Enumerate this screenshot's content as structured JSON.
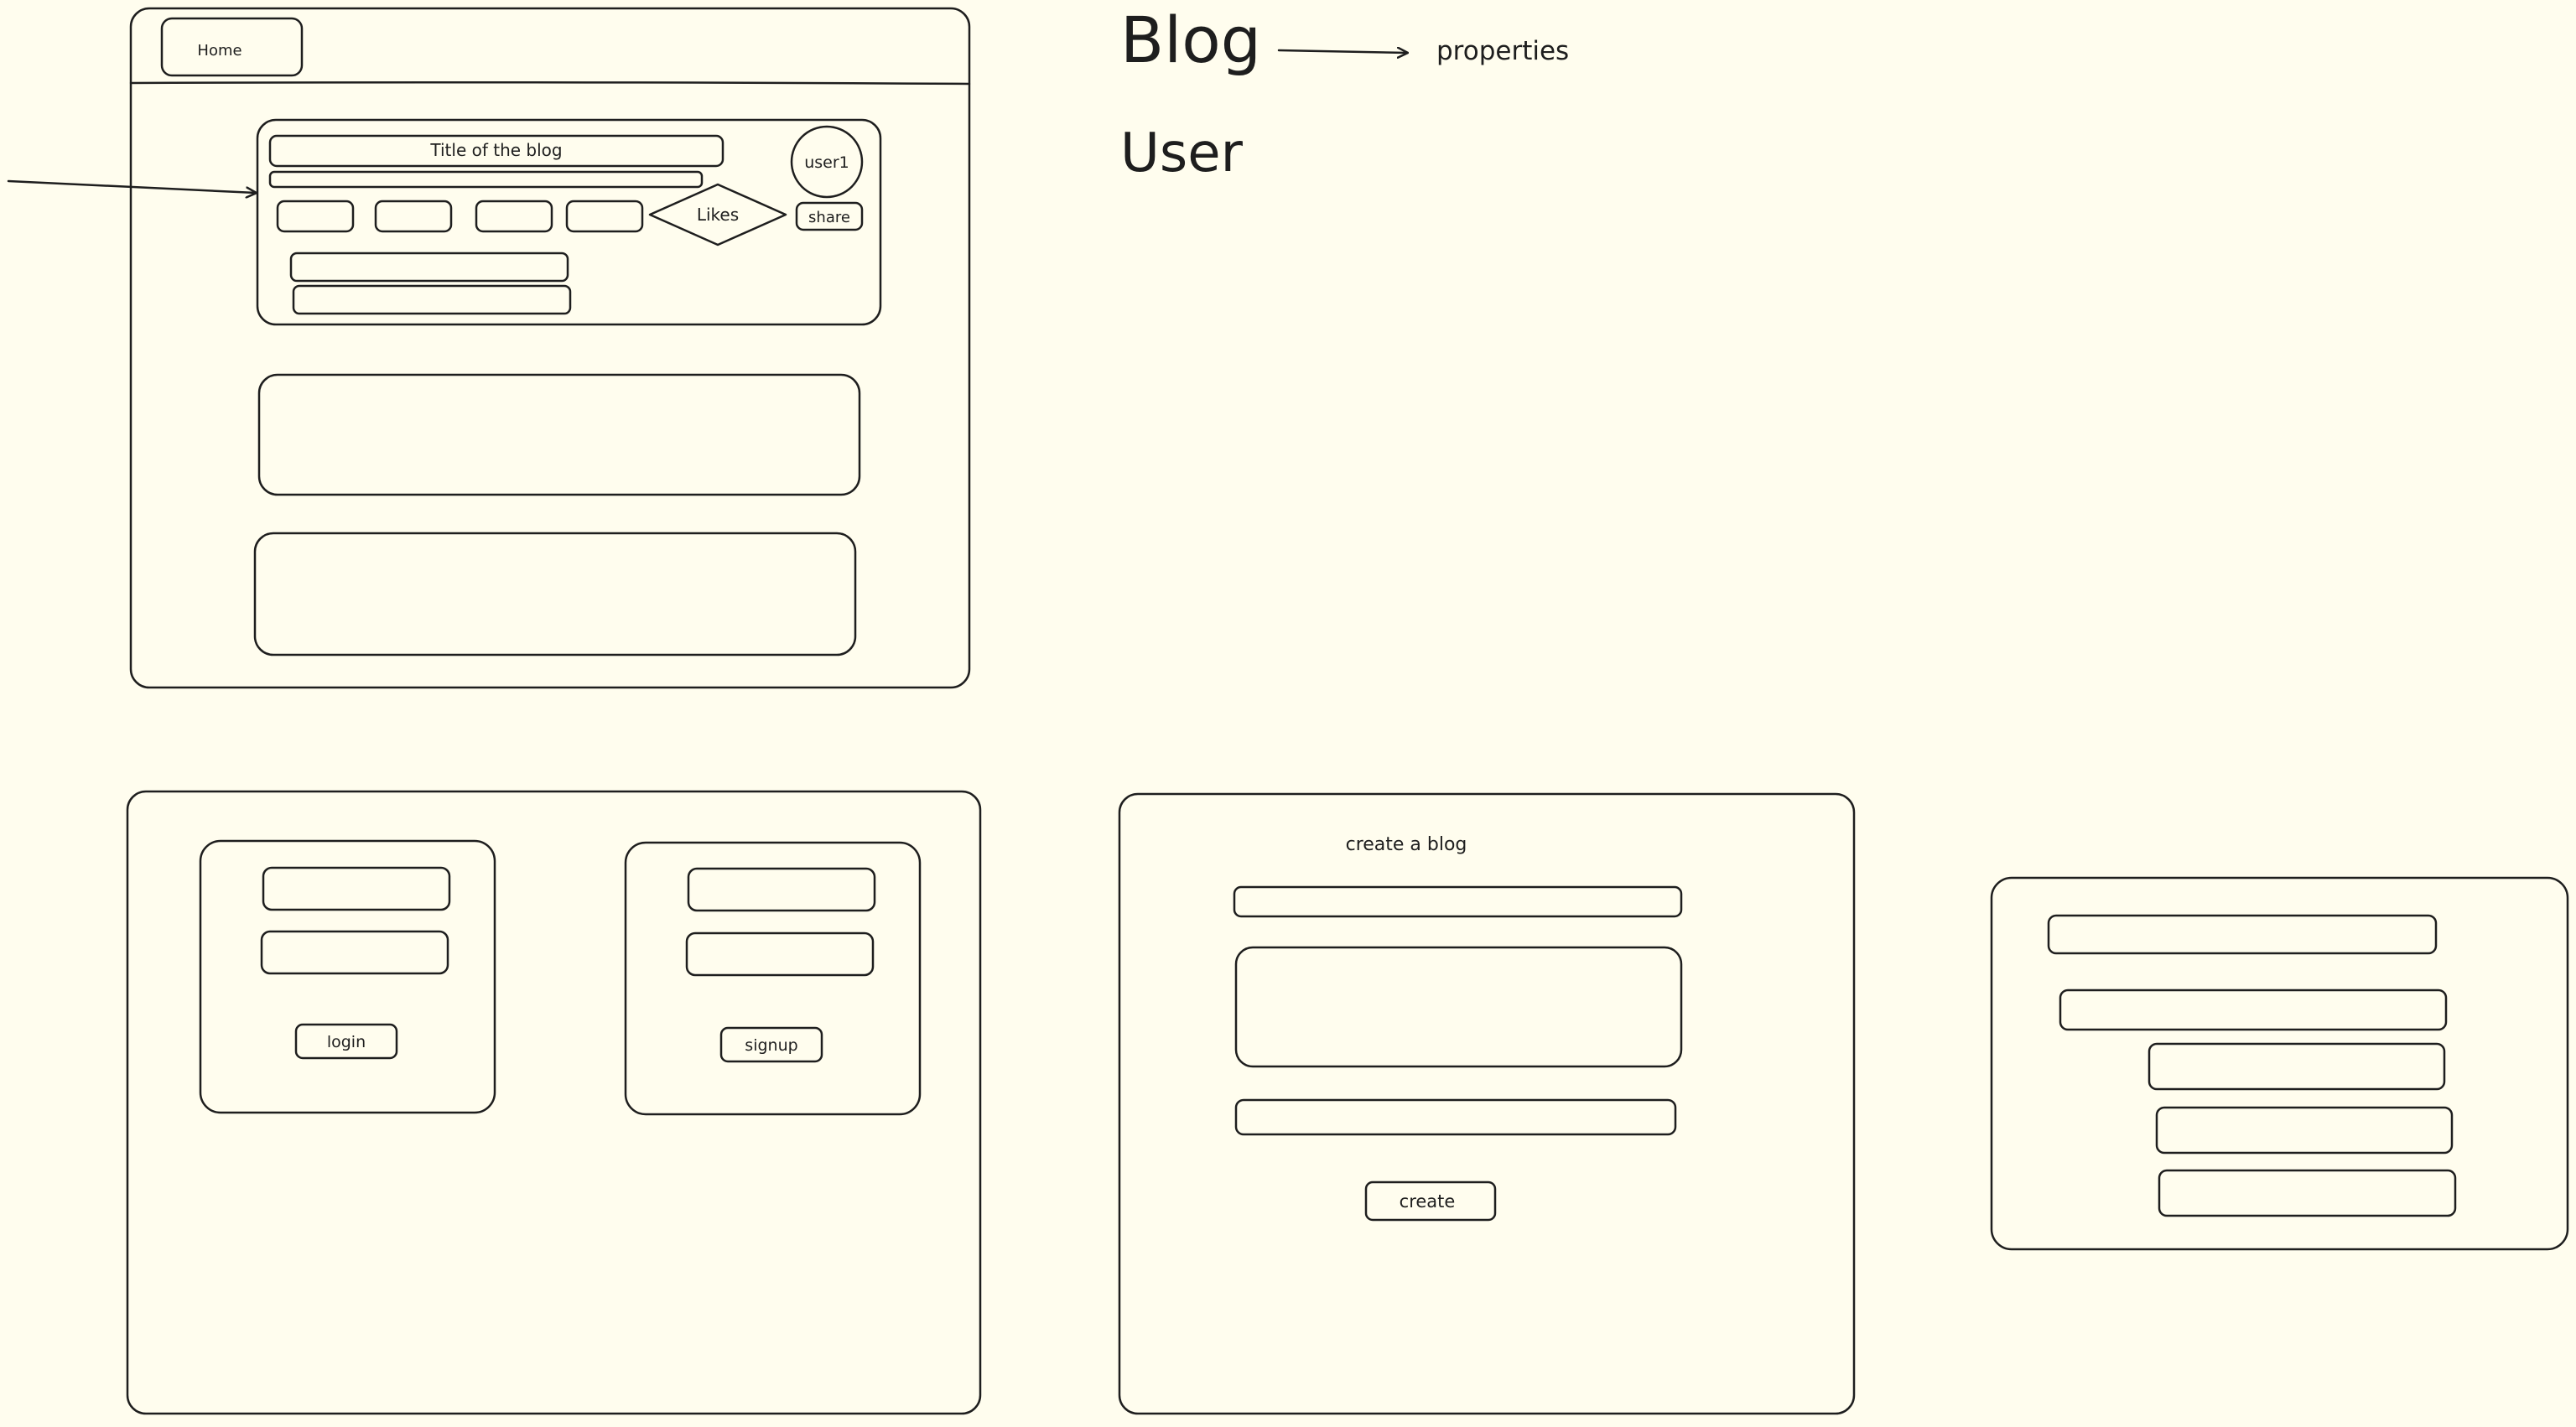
{
  "theme": {
    "background": "#fffdee",
    "stroke": "#1e1e1e"
  },
  "labels": {
    "blog": "Blog",
    "user": "User",
    "properties": "properties"
  },
  "home_wireframe": {
    "nav_button": "Home",
    "post_title": "Title of the blog",
    "user_avatar": "user1",
    "likes": "Likes",
    "share": "share"
  },
  "auth_wireframe": {
    "login_button": "login",
    "signup_button": "signup"
  },
  "create_wireframe": {
    "heading": "create a blog",
    "create_button": "create"
  }
}
